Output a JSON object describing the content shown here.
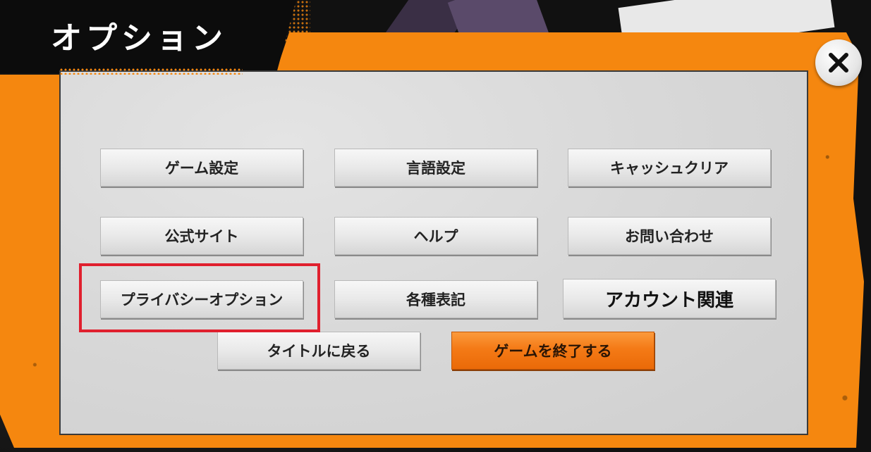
{
  "title": "オプション",
  "colors": {
    "accent_orange": "#f5870f",
    "highlight_red": "#e0202e",
    "title_bar": "#0c0c0c"
  },
  "close_icon": "close-icon",
  "buttons": {
    "game_settings": "ゲーム設定",
    "language_settings": "言語設定",
    "cache_clear": "キャッシュクリア",
    "official_site": "公式サイト",
    "help": "ヘルプ",
    "contact": "お問い合わせ",
    "privacy_options": "プライバシーオプション",
    "notices": "各種表記",
    "account": "アカウント関連",
    "back_to_title": "タイトルに戻る",
    "quit_game": "ゲームを終了する"
  }
}
